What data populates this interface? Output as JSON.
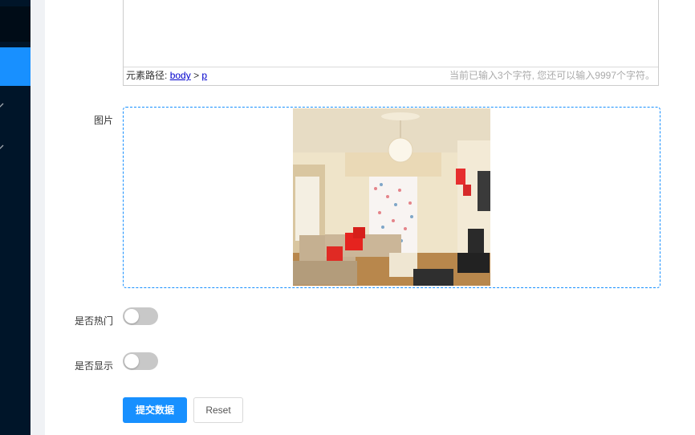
{
  "sidebar": {
    "chevrons": [
      "chevron-down-icon",
      "chevron-down-icon"
    ]
  },
  "editor": {
    "path_label": "元素路径:",
    "path_items": [
      "body",
      "p"
    ],
    "path_separator": ">",
    "word_count": "当前已输入3个字符, 您还可以输入9997个字符。"
  },
  "form": {
    "image_label": "图片",
    "hot_label": "是否热门",
    "hot_value": false,
    "show_label": "是否显示",
    "show_value": false,
    "submit_label": "提交数据",
    "reset_label": "Reset"
  },
  "colors": {
    "primary": "#1890ff",
    "sidebar": "#001529",
    "switch_off": "#c8c8c8"
  }
}
